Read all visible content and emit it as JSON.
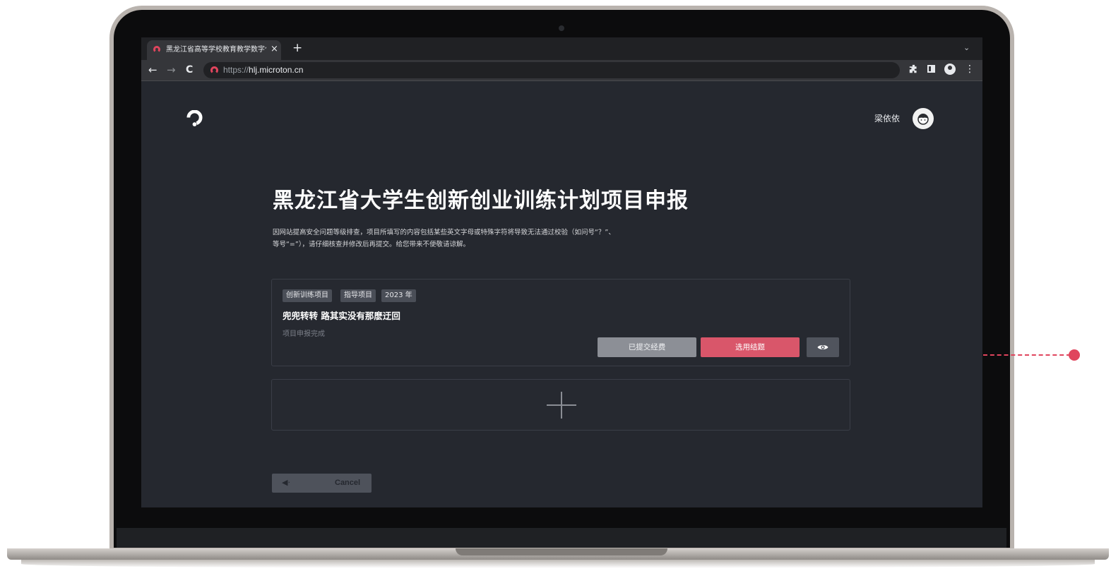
{
  "browser": {
    "tab_title": "黑龙江省高等学校教育教学数字化",
    "tab_close": "×",
    "new_tab": "+",
    "tab_list": "⌄",
    "back": "←",
    "forward": "→",
    "reload": "C",
    "url_scheme": "https://",
    "url_host": "hlj.microton.cn",
    "menu": "⋮",
    "accent_color": "#e0455d"
  },
  "header": {
    "username": "梁依依"
  },
  "main": {
    "title": "黑龙江省大学生创新创业训练计划项目申报",
    "notice_line1": "因网站提高安全问题等级排查，项目所填写的内容包括某些英文字母或特殊字符将导致无法通过校验（如问号“？”、",
    "notice_line2": "等号“=”），请仔细核查并修改后再提交。给您带来不便敬请谅解。"
  },
  "project_card": {
    "tags": [
      "创新训练项目",
      "指导项目",
      "2023 年"
    ],
    "title": "兜兜转转 路其实没有那麽迂回",
    "status": "项目申报完成",
    "btn_submitted": "已提交经费",
    "btn_select": "选用结题",
    "btn_view_icon": "eye-icon"
  },
  "add_project": {
    "icon": "plus-icon"
  },
  "footer": {
    "cancel_label": "Cancel",
    "cancel_icon": "◀·"
  },
  "colors": {
    "page_bg": "#25282f",
    "primary_button": "#d9566a",
    "secondary_button": "#8c8f96"
  }
}
